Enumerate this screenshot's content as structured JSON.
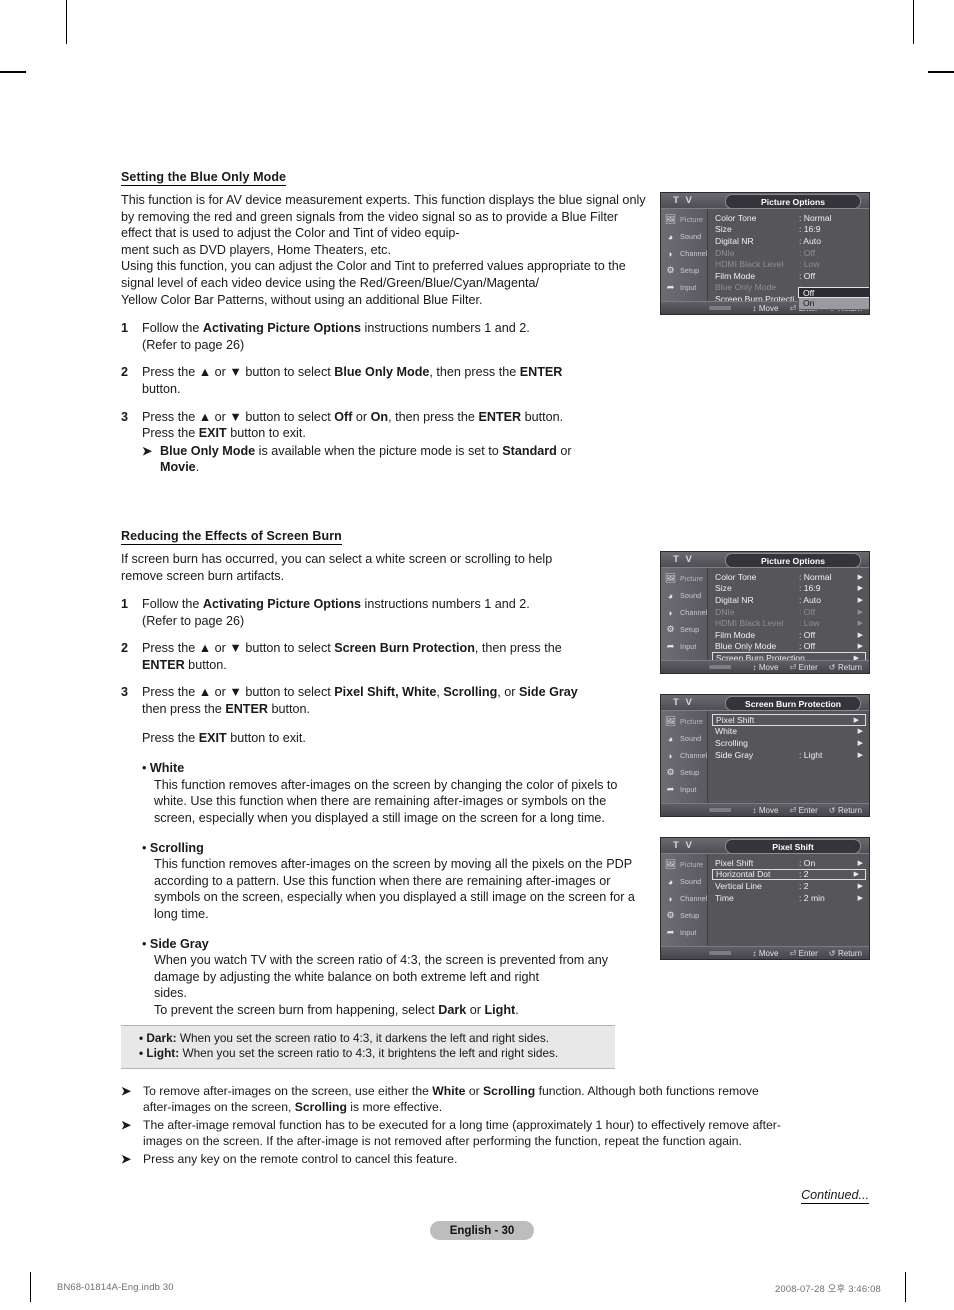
{
  "section1": {
    "heading": "Setting the Blue Only Mode",
    "intro": "This function is for AV device measurement experts. This function displays the blue signal only by removing the red and green signals from the video signal so as to provide a Blue Filter effect that is used to adjust the Color and Tint of video equipment such as DVD players, Home Theaters, etc.\nUsing this function, you can adjust the Color and Tint to preferred values appropriate to the signal level of each video device using the Red/Green/Blue/Cyan/Magenta/Yellow Color Bar Patterns, without using an additional Blue Filter.",
    "steps": [
      {
        "num": "1",
        "line1_a": "Follow the ",
        "line1_b": "Activating Picture Options",
        "line1_c": " instructions numbers 1 and 2.",
        "line2": "(Refer to page 26)"
      },
      {
        "num": "2",
        "text": "Press the ▲ or ▼ button to select Blue Only Mode, then press the ENTER button."
      },
      {
        "num": "3",
        "text": "Press the ▲ or ▼ button to select Off or On, then press the ENTER button. Press the EXIT button to exit."
      }
    ],
    "note": "Blue Only Mode is available when the picture mode is set to Standard or Movie.",
    "arrow_glyph": "➤"
  },
  "section2": {
    "heading": "Reducing the Effects of Screen Burn",
    "intro": "If screen burn has occurred, you can select a white screen or scrolling to help remove screen burn artifacts.",
    "steps": [
      {
        "num": "1",
        "line1": "Follow the Activating Picture Options instructions numbers 1 and 2.",
        "line2": "(Refer to page 26)"
      },
      {
        "num": "2",
        "text": "Press the ▲ or ▼ button to select Screen Burn Protection, then press the ENTER button."
      },
      {
        "num": "3",
        "text": "Press the ▲ or ▼ button to select Pixel Shift, White, Scrolling, or Side Gray then press the ENTER button."
      }
    ],
    "exit_line": "Press the EXIT button to exit.",
    "bullets": [
      {
        "title": "White",
        "body": "This function removes after-images on the screen by changing the color of pixels to white. Use this function when there are remaining after-images or symbols on the screen, especially when you displayed a still image on the screen for a long time."
      },
      {
        "title": "Scrolling",
        "body": "This function removes after-images on the screen by moving all the pixels on the PDP according to a pattern. Use this function when there are remaining after-images or symbols on the screen, especially when you displayed a still image on the screen for a long time."
      },
      {
        "title": "Side Gray",
        "body": "When you watch TV with the screen ratio of 4:3, the screen is prevented from any damage by adjusting the white balance on both extreme left and right sides.\nTo prevent the screen burn from happening, select Dark or Light."
      }
    ],
    "graybox": [
      {
        "label": "• Dark:",
        "text": " When you set the screen ratio to 4:3, it darkens the left and right sides."
      },
      {
        "label": "• Light:",
        "text": " When you set the screen ratio to 4:3, it brightens the left and right sides."
      }
    ]
  },
  "bottom_notes": [
    "To remove after-images on the screen, use either the White or Scrolling function. Although both functions remove after-images on the screen, Scrolling is more effective.",
    "The after-image removal function has to be executed for a long time (approximately 1 hour) to effectively remove after-images on the screen. If the after-image is not removed after performing the function, repeat the function again.",
    "Press any key on the remote control to cancel this feature."
  ],
  "continued_label": "Continued...",
  "page_label": "English - 30",
  "footer": {
    "left": "BN68-01814A-Eng.indb   30",
    "right": "2008-07-28   오후 3:46:08"
  },
  "osd_common": {
    "tv_label": "T V",
    "sidebar": [
      {
        "icon": "picture-icon",
        "glyph": "▣",
        "label": "Picture"
      },
      {
        "icon": "sound-icon",
        "glyph": "◕",
        "label": "Sound"
      },
      {
        "icon": "channel-icon",
        "glyph": "◗",
        "label": "Channel"
      },
      {
        "icon": "setup-icon",
        "glyph": "⚙",
        "label": "Setup"
      },
      {
        "icon": "input-icon",
        "glyph": "➦",
        "label": "Input"
      }
    ],
    "footer": [
      {
        "icon": "updown-icon",
        "glyph": "↕",
        "label": "Move"
      },
      {
        "icon": "enter-icon",
        "glyph": "⏎",
        "label": "Enter"
      },
      {
        "icon": "return-icon",
        "glyph": "↺",
        "label": "Return"
      }
    ],
    "arrow_glyph": "▶"
  },
  "menu1": {
    "title": "Picture Options",
    "rows": [
      {
        "label": "Color Tone",
        "value": ": Normal",
        "dim": false,
        "arrow": false
      },
      {
        "label": "Size",
        "value": ": 16:9",
        "dim": false,
        "arrow": false
      },
      {
        "label": "Digital NR",
        "value": ": Auto",
        "dim": false,
        "arrow": false
      },
      {
        "label": "DNIe",
        "value": ": Off",
        "dim": true,
        "arrow": false
      },
      {
        "label": "HDMI Black Level",
        "value": ": Low",
        "dim": true,
        "arrow": false
      },
      {
        "label": "Film Mode",
        "value": ": Off",
        "dim": false,
        "arrow": false
      },
      {
        "label": "Blue Only Mode",
        "value": ":",
        "dim": true,
        "arrow": false
      },
      {
        "label": "Screen Burn Protecti",
        "value": "",
        "dim": false,
        "arrow": false
      }
    ],
    "dropdown": {
      "selected": "Off",
      "other": "On"
    }
  },
  "menu2": {
    "title": "Picture Options",
    "rows": [
      {
        "label": "Color Tone",
        "value": ": Normal",
        "dim": false,
        "arrow": true,
        "selected": false
      },
      {
        "label": "Size",
        "value": ": 16:9",
        "dim": false,
        "arrow": true,
        "selected": false
      },
      {
        "label": "Digital NR",
        "value": ": Auto",
        "dim": false,
        "arrow": true,
        "selected": false
      },
      {
        "label": "DNIe",
        "value": ": Off",
        "dim": true,
        "arrow": true,
        "selected": false
      },
      {
        "label": "HDMI Black Level",
        "value": ": Low",
        "dim": true,
        "arrow": true,
        "selected": false
      },
      {
        "label": "Film Mode",
        "value": ": Off",
        "dim": false,
        "arrow": true,
        "selected": false
      },
      {
        "label": "Blue Only Mode",
        "value": ": Off",
        "dim": false,
        "arrow": true,
        "selected": false
      },
      {
        "label": "Screen Burn Protection",
        "value": "",
        "dim": false,
        "arrow": true,
        "selected": true
      }
    ]
  },
  "menu3": {
    "title": "Screen Burn Protection",
    "rows": [
      {
        "label": "Pixel Shift",
        "value": "",
        "dim": false,
        "arrow": true,
        "selected": true
      },
      {
        "label": "White",
        "value": "",
        "dim": false,
        "arrow": true,
        "selected": false
      },
      {
        "label": "Scrolling",
        "value": "",
        "dim": false,
        "arrow": true,
        "selected": false
      },
      {
        "label": "Side Gray",
        "value": ": Light",
        "dim": false,
        "arrow": true,
        "selected": false
      }
    ]
  },
  "menu4": {
    "title": "Pixel Shift",
    "rows": [
      {
        "label": "Pixel Shift",
        "value": ": On",
        "dim": false,
        "arrow": true,
        "selected": false
      },
      {
        "label": "Horizontal Dot",
        "value": ": 2",
        "dim": false,
        "arrow": true,
        "selected": true
      },
      {
        "label": "Vertical Line",
        "value": ": 2",
        "dim": false,
        "arrow": true,
        "selected": false
      },
      {
        "label": "Time",
        "value": ": 2 min",
        "dim": false,
        "arrow": true,
        "selected": false
      }
    ]
  }
}
